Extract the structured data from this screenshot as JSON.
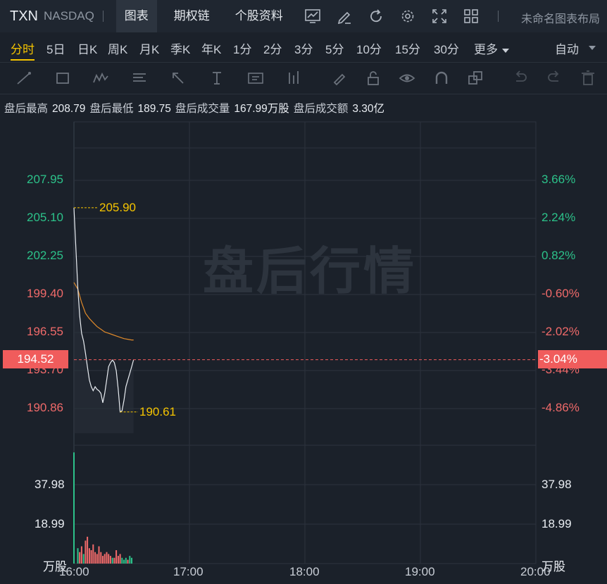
{
  "header": {
    "symbol": "TXN",
    "exchange": "NASDAQ",
    "tabs": [
      {
        "label": "图表",
        "active": true
      },
      {
        "label": "期权链",
        "active": false
      },
      {
        "label": "个股资料",
        "active": false
      }
    ],
    "icons": [
      "indicator-icon",
      "draw-pen-icon",
      "refresh-icon",
      "settings-icon",
      "fullscreen-icon",
      "layout-grid-icon"
    ],
    "layout_label": "未命名图表布局"
  },
  "periods": {
    "items": [
      "分时",
      "5日",
      "日K",
      "周K",
      "月K",
      "季K",
      "年K",
      "1分",
      "2分",
      "3分",
      "5分",
      "10分",
      "15分",
      "30分",
      "更多"
    ],
    "active": "分时",
    "mode": "自动"
  },
  "drawing_tools": [
    "line-tool-icon",
    "rectangle-tool-icon",
    "pattern-tool-icon",
    "fib-tool-icon",
    "arrow-tool-icon",
    "text-cursor-tool-icon",
    "text-box-tool-icon",
    "measure-tool-icon",
    "brush-icon",
    "lock-icon",
    "eye-icon",
    "magnet-icon",
    "copy-icon",
    "undo-icon",
    "redo-icon",
    "trash-icon"
  ],
  "info": {
    "high_label": "盘后最高",
    "high": "208.79",
    "low_label": "盘后最低",
    "low": "189.75",
    "vol_label": "盘后成交量",
    "vol": "167.99万股",
    "amt_label": "盘后成交额",
    "amt": "3.30亿"
  },
  "watermark": "盘后行情",
  "colors": {
    "up": "#2cc28a",
    "down": "#f06a6a",
    "accent": "#f5c400",
    "avg_line": "#e08a2a",
    "current": "#f05c5c"
  },
  "price_axis": [
    {
      "price": "207.95",
      "pct": "3.66%",
      "dir": "up"
    },
    {
      "price": "205.10",
      "pct": "2.24%",
      "dir": "up"
    },
    {
      "price": "202.25",
      "pct": "0.82%",
      "dir": "up"
    },
    {
      "price": "199.40",
      "pct": "-0.60%",
      "dir": "down"
    },
    {
      "price": "196.55",
      "pct": "-2.02%",
      "dir": "down"
    },
    {
      "price": "193.70",
      "pct": "-3.44%",
      "dir": "down"
    },
    {
      "price": "190.86",
      "pct": "-4.86%",
      "dir": "down"
    }
  ],
  "current": {
    "price": "194.52",
    "pct": "-3.04%"
  },
  "annotations": {
    "high": "205.90",
    "low": "190.61"
  },
  "volume_axis": {
    "labels": [
      "37.98",
      "18.99"
    ],
    "unit": "万股"
  },
  "time_axis": [
    "16:00",
    "17:00",
    "18:00",
    "19:00",
    "20:00"
  ],
  "chart_data": {
    "type": "line",
    "x_unit": "minutes after 16:00",
    "price_series": [
      [
        0,
        205.9
      ],
      [
        2,
        199.9
      ],
      [
        3,
        197.8
      ],
      [
        4,
        196.5
      ],
      [
        5,
        195.9
      ],
      [
        6,
        195.0
      ],
      [
        7,
        194.0
      ],
      [
        8,
        193.0
      ],
      [
        9,
        192.5
      ],
      [
        10,
        192.2
      ],
      [
        11,
        192.5
      ],
      [
        12,
        192.3
      ],
      [
        13,
        192.2
      ],
      [
        14,
        192.0
      ],
      [
        15,
        191.3
      ],
      [
        16,
        192.0
      ],
      [
        17,
        193.0
      ],
      [
        18,
        194.0
      ],
      [
        19,
        194.3
      ],
      [
        20,
        194.5
      ],
      [
        21,
        194.3
      ],
      [
        22,
        193.7
      ],
      [
        23,
        192.3
      ],
      [
        24,
        190.61
      ],
      [
        25,
        190.7
      ],
      [
        26,
        191.5
      ],
      [
        27,
        192.5
      ],
      [
        28,
        193.0
      ],
      [
        29,
        193.5
      ],
      [
        30,
        194.0
      ],
      [
        31,
        194.52
      ]
    ],
    "avg_series": [
      [
        0,
        200.3
      ],
      [
        2,
        199.8
      ],
      [
        4,
        198.8
      ],
      [
        6,
        198.0
      ],
      [
        8,
        197.6
      ],
      [
        10,
        197.3
      ],
      [
        12,
        197.0
      ],
      [
        14,
        196.8
      ],
      [
        16,
        196.6
      ],
      [
        18,
        196.5
      ],
      [
        20,
        196.4
      ],
      [
        22,
        196.3
      ],
      [
        24,
        196.2
      ],
      [
        26,
        196.1
      ],
      [
        28,
        196.05
      ],
      [
        30,
        196.0
      ],
      [
        31,
        196.0
      ]
    ],
    "volume": [
      [
        0,
        58,
        "up"
      ],
      [
        2,
        8,
        "up"
      ],
      [
        3,
        6,
        "down"
      ],
      [
        4,
        9,
        "down"
      ],
      [
        5,
        5,
        "up"
      ],
      [
        6,
        12,
        "down"
      ],
      [
        7,
        14,
        "down"
      ],
      [
        8,
        8,
        "down"
      ],
      [
        9,
        7,
        "down"
      ],
      [
        10,
        10,
        "down"
      ],
      [
        11,
        6,
        "down"
      ],
      [
        12,
        5,
        "down"
      ],
      [
        13,
        9,
        "down"
      ],
      [
        14,
        6,
        "down"
      ],
      [
        15,
        4,
        "down"
      ],
      [
        16,
        5,
        "down"
      ],
      [
        17,
        6,
        "down"
      ],
      [
        18,
        5,
        "down"
      ],
      [
        19,
        4,
        "down"
      ],
      [
        20,
        3,
        "up"
      ],
      [
        21,
        3,
        "down"
      ],
      [
        22,
        7,
        "down"
      ],
      [
        23,
        4,
        "down"
      ],
      [
        24,
        5,
        "down"
      ],
      [
        25,
        3,
        "up"
      ],
      [
        26,
        2,
        "up"
      ],
      [
        27,
        3,
        "up"
      ],
      [
        28,
        2,
        "down"
      ],
      [
        29,
        4,
        "up"
      ],
      [
        30,
        3,
        "up"
      ]
    ],
    "price_range": [
      190.86,
      207.95
    ],
    "volume_range": [
      0,
      56.97
    ],
    "time_range_minutes": [
      0,
      240
    ]
  }
}
